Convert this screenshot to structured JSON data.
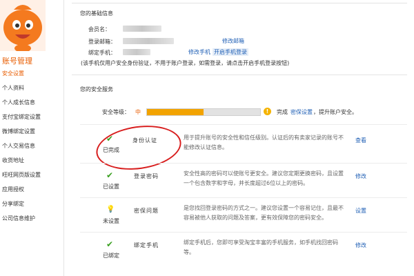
{
  "sidebar": {
    "title": "账号管理",
    "items": [
      {
        "label": "安全设置",
        "active": true
      },
      {
        "label": "个人资料"
      },
      {
        "label": "个人成长信息"
      },
      {
        "label": "支付宝绑定设置"
      },
      {
        "label": "微博绑定设置"
      },
      {
        "label": "个人交易信息"
      },
      {
        "label": "收货地址"
      },
      {
        "label": "旺旺网页版设置"
      },
      {
        "label": "应用授权"
      },
      {
        "label": "分享绑定"
      },
      {
        "label": "公司信息维护"
      }
    ]
  },
  "basic_info": {
    "title": "您的基础信息",
    "member_label": "会员名：",
    "email_label": "登录邮箱：",
    "email_action": "修改邮箱",
    "phone_label": "绑定手机：",
    "phone_action_modify": "修改手机",
    "phone_action_enable": "开启手机登录",
    "note": "(该手机仅用户安全身份验证，不用于账户登录，如需登录，请点击开启手机登录按钮)"
  },
  "security": {
    "title": "您的安全服务",
    "level_label": "安全等级：",
    "level_value": "中",
    "level_fraction": 0.5,
    "level_hint_prefix": "完成",
    "level_hint_link": "密保设置",
    "level_hint_suffix": "，提升账户安全。",
    "items": [
      {
        "icon": "check-icon",
        "status": "已完成",
        "name": "身份认证",
        "desc_line1": "用于提升账号的安全性和信任级别。认证后的有卖家记录的账号不",
        "desc_line2": "能修改认证信息。",
        "action": "查看"
      },
      {
        "icon": "check-icon",
        "status": "已设置",
        "name": "登录密码",
        "desc_line1": "安全性高的密码可以使账号更安全。建议您定期更换密码，且设置",
        "desc_line2": "一个包含数字和字母，并长度超过6位以上的密码。",
        "action": "修改"
      },
      {
        "icon": "bulb-icon",
        "status": "未设置",
        "name": "密保问题",
        "desc_line1": "是您找回登录密码的方式之一。建议您设置一个容易记住，且最不",
        "desc_line2": "容易被他人获取的问题及答案，更有效保障您的密码安全。",
        "action": "设置"
      },
      {
        "icon": "check-icon",
        "status": "已绑定",
        "name": "绑定手机",
        "desc_line1": "绑定手机后，您即可享受淘宝丰富的手机服务，如手机找回密码",
        "desc_line2": "等。",
        "action": "修改"
      }
    ]
  },
  "colors": {
    "accent": "#e85c00",
    "link": "#1f5fb5",
    "success": "#3aa021",
    "progress": "#f2a300",
    "annotation": "#d81e1e"
  }
}
